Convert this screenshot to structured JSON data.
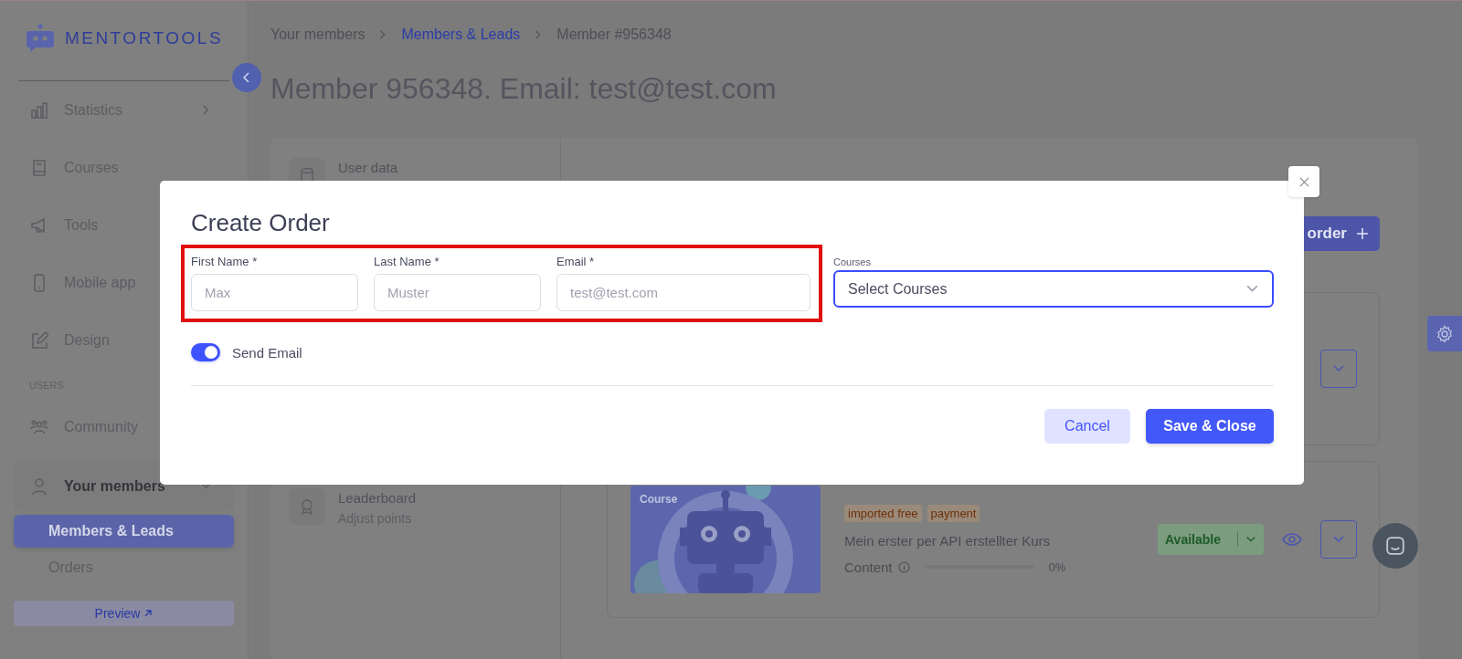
{
  "sidebar": {
    "logo": "MENTORTOOLS",
    "sections": [
      {
        "items": [
          {
            "label": "Statistics",
            "selected": false,
            "expanded": false
          },
          {
            "label": "Courses",
            "selected": false
          },
          {
            "label": "Tools",
            "selected": false
          },
          {
            "label": "Mobile app",
            "selected": false
          },
          {
            "label": "Design",
            "selected": false
          }
        ]
      },
      {
        "heading": "USERS",
        "items": [
          {
            "label": "Community",
            "selected": false
          },
          {
            "label": "Your members",
            "selected": false,
            "expanded": true,
            "children": [
              {
                "label": "Members & Leads",
                "selected": true
              },
              {
                "label": "Orders",
                "selected": false
              }
            ]
          }
        ]
      }
    ],
    "preview": "Preview"
  },
  "breadcrumb": [
    {
      "label": "Your members",
      "kind": "plain"
    },
    {
      "label": "Members & Leads",
      "kind": "link"
    },
    {
      "label": "Member #956348",
      "kind": "plain"
    }
  ],
  "title": "Member 956348. Email: test@test.com",
  "left_panel": [
    {
      "title": "User data"
    },
    {
      "title": "Leaderboard",
      "subtitle": "Adjust points"
    }
  ],
  "order_button": "order",
  "course_cards": [
    {
      "kind": "covered"
    },
    {
      "kind": "full",
      "image_label": "Course",
      "tags": [
        "imported free",
        "payment"
      ],
      "title": "Mein erster per API erstellter Kurs",
      "progress_label": "Content",
      "level": 0,
      "reading": "0%",
      "status": "Available"
    }
  ],
  "modal": {
    "title": "Create Order",
    "fields": [
      {
        "label": "First Name *",
        "placeholder": "Max"
      },
      {
        "label": "Last Name *",
        "placeholder": "Muster"
      },
      {
        "label": "Email *",
        "placeholder": "test@test.com"
      }
    ],
    "courses": {
      "label": "Courses",
      "placeholder": "Select Courses",
      "focused": true
    },
    "toggle": {
      "label": "Send Email",
      "on": true
    },
    "buttons": [
      {
        "label": "Cancel",
        "kind": "secondary"
      },
      {
        "label": "Save & Close",
        "kind": "primary"
      }
    ]
  }
}
